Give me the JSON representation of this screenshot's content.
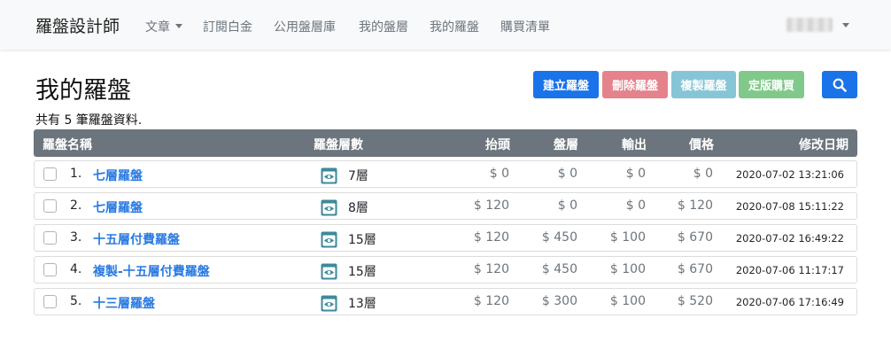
{
  "navbar": {
    "brand": "羅盤設計師",
    "items": [
      {
        "label": "文章",
        "dropdown": true
      },
      {
        "label": "訂閱白金"
      },
      {
        "label": "公用盤層庫"
      },
      {
        "label": "我的盤層"
      },
      {
        "label": "我的羅盤"
      },
      {
        "label": "購買清單"
      }
    ]
  },
  "page": {
    "title": "我的羅盤",
    "summary": "共有 5 筆羅盤資料.",
    "buttons": {
      "create": "建立羅盤",
      "delete": "刪除羅盤",
      "copy": "複製羅盤",
      "buy": "定版購買"
    }
  },
  "table": {
    "headers": {
      "name": "羅盤名稱",
      "layers": "羅盤層數",
      "head": "抬頭",
      "plate": "盤層",
      "output": "輸出",
      "price": "價格",
      "modified": "修改日期"
    },
    "rows": [
      {
        "index": "1.",
        "name": "七層羅盤",
        "layers": "7層",
        "head": "$ 0",
        "plate": "$ 0",
        "output": "$ 0",
        "price": "$ 0",
        "modified": "2020-07-02 13:21:06"
      },
      {
        "index": "2.",
        "name": "七層羅盤",
        "layers": "8層",
        "head": "$ 120",
        "plate": "$ 0",
        "output": "$ 0",
        "price": "$ 120",
        "modified": "2020-07-08 15:11:22"
      },
      {
        "index": "3.",
        "name": "十五層付費羅盤",
        "layers": "15層",
        "head": "$ 120",
        "plate": "$ 450",
        "output": "$ 100",
        "price": "$ 670",
        "modified": "2020-07-02 16:49:22"
      },
      {
        "index": "4.",
        "name": "複製-十五層付費羅盤",
        "layers": "15層",
        "head": "$ 120",
        "plate": "$ 450",
        "output": "$ 100",
        "price": "$ 670",
        "modified": "2020-07-06 11:17:17"
      },
      {
        "index": "5.",
        "name": "十三層羅盤",
        "layers": "13層",
        "head": "$ 120",
        "plate": "$ 300",
        "output": "$ 100",
        "price": "$ 520",
        "modified": "2020-07-06 17:16:49"
      }
    ]
  },
  "icons": {
    "caret": "chevron-down-icon",
    "search": "search-icon",
    "layer_view": "eye-icon"
  },
  "colors": {
    "primary": "#1a73e8",
    "danger": "#e4838c",
    "info": "#86c5d6",
    "success": "#80c98a",
    "header": "#6c757d",
    "link": "#2a7ae2",
    "eye_icon": "#3c8a9a"
  }
}
